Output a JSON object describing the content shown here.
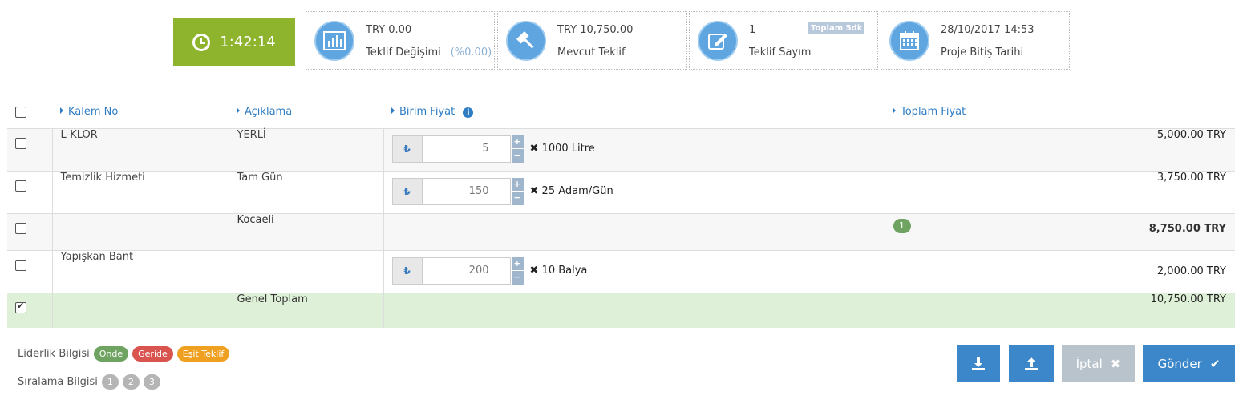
{
  "timer": {
    "value": "1:42:14"
  },
  "stats": [
    {
      "line1": "TRY 0.00",
      "line2": "Teklif Değişimi",
      "pct": "(%0.00)",
      "icon": "bar-chart-icon"
    },
    {
      "line1": "TRY 10,750.00",
      "line2": "Mevcut Teklif",
      "icon": "gavel-icon"
    },
    {
      "line1": "1",
      "line2": "Teklif Sayım",
      "badge": "Toplam 5dk",
      "icon": "edit-icon"
    },
    {
      "line1": "28/10/2017 14:53",
      "line2": "Proje Bitiş Tarihi",
      "icon": "calendar-icon"
    }
  ],
  "table": {
    "headers": [
      "Kalem No",
      "Açıklama",
      "Birim Fiyat",
      "Toplam Fiyat"
    ],
    "rows": [
      {
        "kalem": "L-KLOR",
        "aciklama": "YERLİ",
        "currency": "₺",
        "price": "5",
        "mult": "1000 Litre",
        "total": "5,000.00 TRY"
      },
      {
        "kalem": "Temizlik Hizmeti",
        "aciklama": "Tam Gün",
        "currency": "₺",
        "price": "150",
        "mult": "25 Adam/Gün",
        "total": "3,750.00 TRY"
      },
      {
        "kalem": "",
        "aciklama": "Kocaeli",
        "badge": "1",
        "total": "8,750.00 TRY"
      },
      {
        "kalem": "Yapışkan Bant",
        "aciklama": "",
        "currency": "₺",
        "price": "200",
        "mult": "10 Balya",
        "total": "2,000.00 TRY"
      },
      {
        "kalem": "",
        "aciklama": "Genel Toplam",
        "total": "10,750.00 TRY"
      }
    ]
  },
  "legend": {
    "leadership_label": "Liderlik Bilgisi",
    "ahead": "Önde",
    "behind": "Geride",
    "equal": "Eşit Teklif",
    "ranking_label": "Sıralama Bilgisi",
    "ranks": [
      "1",
      "2",
      "3"
    ]
  },
  "buttons": {
    "cancel": "İptal",
    "send": "Gönder"
  },
  "colors": {
    "timer_bg": "#8db42c",
    "primary": "#3b87c9",
    "ahead": "#6fa362",
    "behind": "#d9534f",
    "equal": "#f0a020",
    "total_row": "#dff0d8"
  }
}
